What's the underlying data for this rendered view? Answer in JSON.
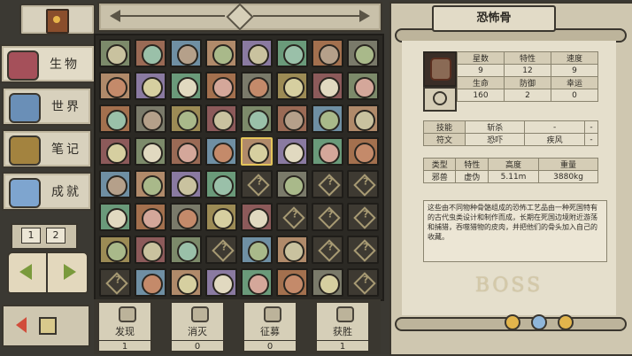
{
  "left_nav": {
    "categories": [
      {
        "label": "生物",
        "icon": "creature-emblem-icon",
        "color": "#a5505a",
        "active": true
      },
      {
        "label": "世界",
        "icon": "world-emblem-icon",
        "color": "#6a8fb7",
        "active": false
      },
      {
        "label": "笔记",
        "icon": "notes-emblem-icon",
        "color": "#a3833f",
        "active": false
      },
      {
        "label": "成就",
        "icon": "achievement-emblem-icon",
        "color": "#7ea5cf",
        "active": false
      }
    ],
    "pages": [
      "1",
      "2"
    ]
  },
  "bottom_stats": [
    {
      "label": "发现",
      "value": "1",
      "icon": "eye-icon"
    },
    {
      "label": "消灭",
      "value": "0",
      "icon": "skull-icon"
    },
    {
      "label": "征募",
      "value": "0",
      "icon": "flag-icon"
    },
    {
      "label": "获胜",
      "value": "1",
      "icon": "fist-icon"
    }
  ],
  "detail": {
    "title": "恐怖骨",
    "stats_header": [
      "星数",
      "特性",
      "速度"
    ],
    "stats_values": [
      "9",
      "12",
      "9"
    ],
    "combat_header": [
      "生命",
      "防御",
      "幸运"
    ],
    "combat_values": [
      "160",
      "2",
      "0"
    ],
    "skills_label": "技能",
    "skills_values": [
      "斩杀",
      "-",
      "-"
    ],
    "rune_label": "符文",
    "rune_values": [
      "恐吓",
      "疾风",
      "-"
    ],
    "type_header": [
      "类型",
      "特性",
      "高度",
      "重量"
    ],
    "type_values": [
      "邪兽",
      "虚伪",
      "5.11m",
      "3880kg"
    ],
    "description": "这些由不同物种骨骼组成的恐怖工艺品由一种死国特有的古代虫类设计和制作而成，长期在死国边境附近游荡和捕猎，吞噬猎物的皮肉，并把他们的骨头加入自己的收藏。",
    "boss_text": "BOSS"
  },
  "accent_colors": {
    "panel": "#cfc7b0",
    "sheet": "#e5dfcc",
    "dark": "#3b3933"
  }
}
